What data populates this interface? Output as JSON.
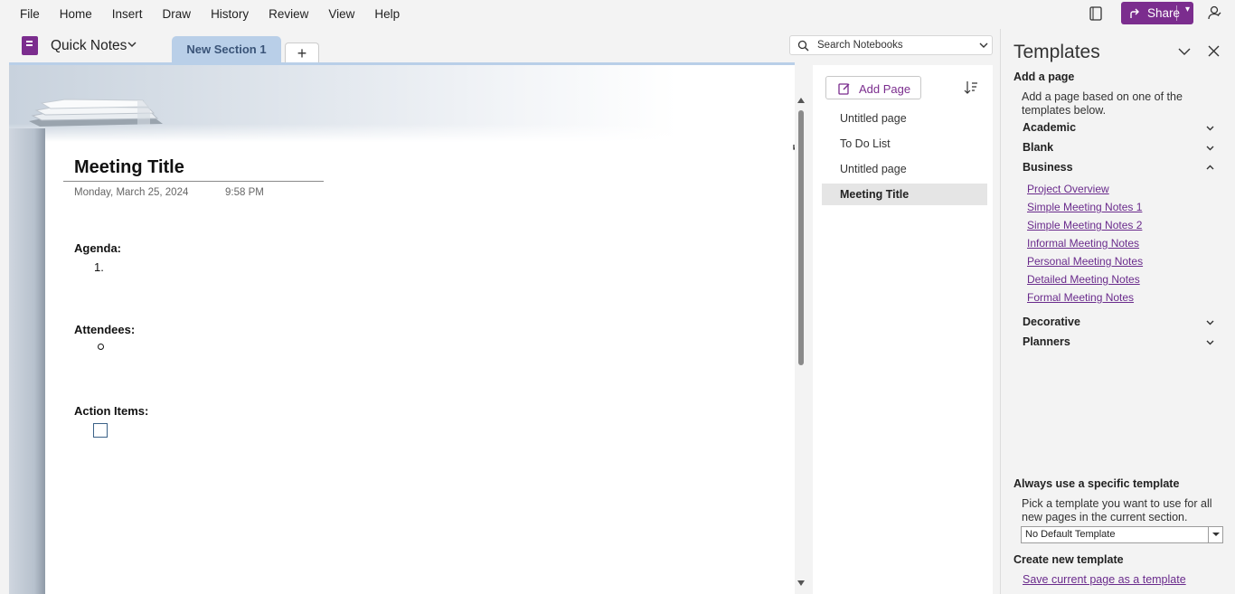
{
  "menu": [
    "File",
    "Home",
    "Insert",
    "Draw",
    "History",
    "Review",
    "View",
    "Help"
  ],
  "share_label": "Share",
  "notebook": {
    "name": "Quick Notes",
    "section_tab": "New Section 1",
    "add_section": "+"
  },
  "search": {
    "placeholder": "Search Notebooks"
  },
  "page": {
    "title": "Meeting Title",
    "date": "Monday, March 25, 2024",
    "time": "9:58 PM",
    "agenda_label": "Agenda:",
    "agenda_first": "1.",
    "attendees_label": "Attendees:",
    "action_label": "Action Items:"
  },
  "pages_panel": {
    "add_page": "Add Page",
    "items": [
      {
        "label": "Untitled page",
        "selected": false
      },
      {
        "label": "To Do List",
        "selected": false
      },
      {
        "label": "Untitled page",
        "selected": false
      },
      {
        "label": "Meeting Title",
        "selected": true
      }
    ]
  },
  "templates": {
    "title": "Templates",
    "add_a_page": "Add a page",
    "add_desc": "Add a page based on one of the templates below.",
    "categories": [
      {
        "label": "Academic",
        "expanded": false
      },
      {
        "label": "Blank",
        "expanded": false
      },
      {
        "label": "Business",
        "expanded": true
      },
      {
        "label": "Decorative",
        "expanded": false
      },
      {
        "label": "Planners",
        "expanded": false
      }
    ],
    "business_items": [
      "Project Overview",
      "Simple Meeting Notes 1",
      "Simple Meeting Notes 2",
      "Informal Meeting Notes",
      "Personal Meeting Notes",
      "Detailed Meeting Notes",
      "Formal Meeting Notes"
    ],
    "always_use": "Always use a specific template",
    "always_desc": "Pick a template you want to use for all new pages in the current section.",
    "default_template": "No Default Template",
    "create_new": "Create new template",
    "save_link": "Save current page as a template"
  },
  "colors": {
    "accent": "#7b2d8e",
    "tab": "#b9cfe8",
    "link": "#6a2b8c"
  }
}
